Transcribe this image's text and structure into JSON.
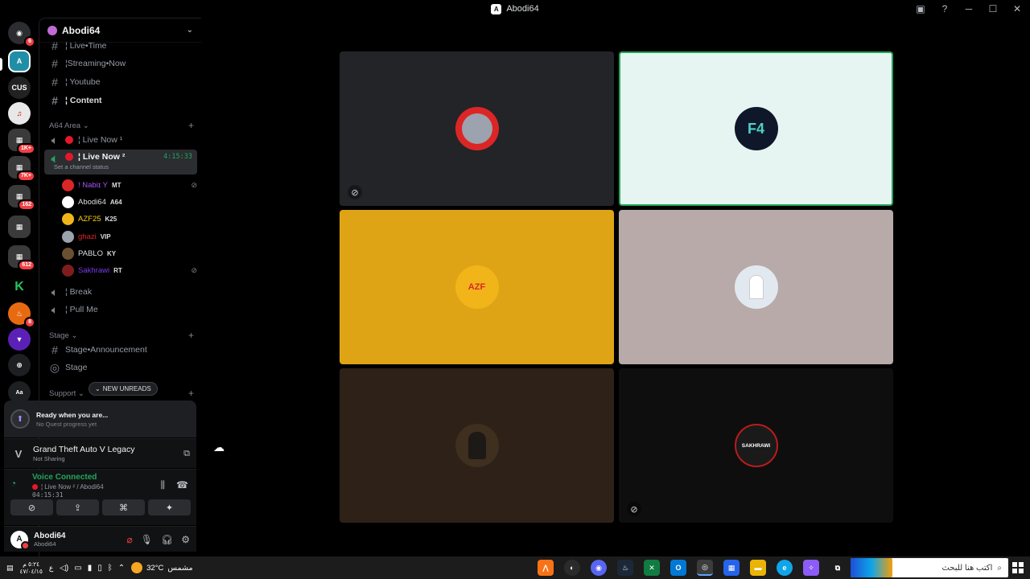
{
  "window": {
    "title": "Abodi64"
  },
  "rail": {
    "servers": [
      {
        "name": "discord-home",
        "badge": "6",
        "color": "#5865f2"
      },
      {
        "name": "abodi64-server",
        "badge": "",
        "color": "#1f8fa8"
      },
      {
        "name": "customs",
        "badge": "",
        "color": "#222222"
      },
      {
        "name": "server-red",
        "badge": "",
        "color": "#e8e8e8"
      },
      {
        "name": "folder-1k",
        "badge": "1K+",
        "color": "#3a3a3a"
      },
      {
        "name": "folder-7k",
        "badge": "7K+",
        "color": "#3a3a3a"
      },
      {
        "name": "folder-162",
        "badge": "162",
        "color": "#3a3a3a"
      },
      {
        "name": "folder-2",
        "badge": "",
        "color": "#3a3a3a"
      },
      {
        "name": "folder-612",
        "badge": "612",
        "color": "#3a3a3a"
      },
      {
        "name": "kick",
        "badge": "",
        "color": "#000000"
      },
      {
        "name": "flame",
        "badge": "8",
        "color": "#e86a10"
      },
      {
        "name": "purple",
        "badge": "",
        "color": "#5b21b6"
      },
      {
        "name": "add-server",
        "badge": "",
        "color": "#1e1f22"
      }
    ]
  },
  "sidebar": {
    "guild_name": "Abodi64",
    "channels_top": [
      {
        "label": "¦ Live•Time",
        "icon": "text"
      },
      {
        "label": "¦Streaming•Now",
        "icon": "text"
      },
      {
        "label": "¦ Youtube",
        "icon": "text"
      },
      {
        "label": "¦ Content",
        "icon": "text"
      }
    ],
    "category_a64": "A64 Area",
    "voice_channels": [
      {
        "label": "¦ Live Now ¹"
      },
      {
        "label": "¦ Live Now ²",
        "timer": "4:15:33",
        "status": "Set a channel status"
      }
    ],
    "voice_users": [
      {
        "name": "! Nabiɪ Y",
        "tag": "MT",
        "color": "#a855f7"
      },
      {
        "name": "Abodi64",
        "tag": "A64",
        "color": "#dbdee1"
      },
      {
        "name": "AZF25",
        "tag": "K25",
        "color": "#facc15"
      },
      {
        "name": "ghazi",
        "tag": "VIP",
        "color": "#dc2626"
      },
      {
        "name": "PABLO",
        "tag": "KY",
        "color": "#dbdee1"
      },
      {
        "name": "Sakhrawi",
        "tag": "RT",
        "color": "#7c3aed"
      }
    ],
    "channels_after": [
      {
        "label": "¦ Break"
      },
      {
        "label": "¦ Pull Me"
      }
    ],
    "category_stage": "Stage",
    "stage_channels": [
      {
        "label": "Stage•Announcement"
      },
      {
        "label": "Stage"
      }
    ],
    "category_support": "Support",
    "new_unreads": "NEW UNREADS"
  },
  "panel": {
    "quest_title": "Ready when you are...",
    "quest_sub": "No Quest progress yet",
    "game_title": "Grand Theft Auto V Legacy",
    "game_sub": "Not Sharing",
    "voice_status": "Voice Connected",
    "voice_channel": "¦ Live Now ² / Abodi64",
    "voice_timer": "04:15:31",
    "user_name": "Abodi64",
    "user_status": "Abodi64"
  },
  "tiles": [
    {
      "name": "tile-1",
      "bg": "#222428",
      "avatar_color": "#dc2626",
      "avatar_text": "",
      "border": ""
    },
    {
      "name": "tile-2",
      "bg": "#e6f5f1",
      "avatar_color": "#0f172a",
      "avatar_text": "F4",
      "border": "#23a55a"
    },
    {
      "name": "tile-3",
      "bg": "#dfa316",
      "avatar_color": "#f1b519",
      "avatar_text": "AZF",
      "border": ""
    },
    {
      "name": "tile-4",
      "bg": "#b8aaa8",
      "avatar_color": "#e2e8f0",
      "avatar_text": "",
      "border": ""
    },
    {
      "name": "tile-5",
      "bg": "#2d2118",
      "avatar_color": "#3f2f1f",
      "avatar_text": "",
      "border": ""
    },
    {
      "name": "tile-6",
      "bg": "#0f0e0f",
      "avatar_color": "#1a1a1a",
      "avatar_text": "SAKHRAWI",
      "border": ""
    }
  ],
  "taskbar": {
    "time": "٥:٢٤ م",
    "date": "٤٧/٠٤/١٥",
    "temp": "32°C",
    "weather": "مشمس",
    "search_placeholder": "اكتب هنا للبحث",
    "lang": "ع"
  }
}
